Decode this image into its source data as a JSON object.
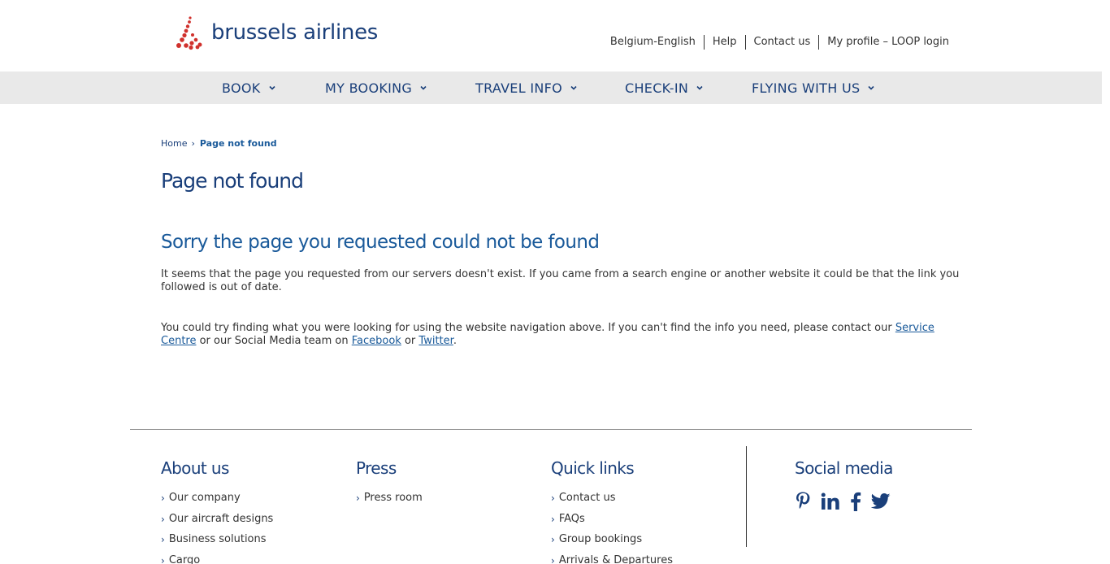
{
  "header": {
    "logo_text": "brussels airlines",
    "util_nav": [
      "Belgium-English",
      "Help",
      "Contact us",
      "My profile – LOOP login"
    ]
  },
  "main_nav": [
    "BOOK",
    "MY BOOKING",
    "TRAVEL INFO",
    "CHECK-IN",
    "FLYING WITH US"
  ],
  "breadcrumb": {
    "home": "Home",
    "current": "Page not found"
  },
  "content": {
    "title": "Page not found",
    "subtitle": "Sorry the page you requested could not be found",
    "para1": "It seems that the page you requested from our servers doesn't exist. If you came from a search engine or another website it could be that the link you followed is out of date.",
    "para2_start": "You could try finding what you were looking for using the website navigation above. If you can't find the info you need, please contact our ",
    "service_centre": "Service Centre",
    "para2_mid": " or our Social Media team on ",
    "facebook": "Facebook",
    "para2_or": " or ",
    "twitter": "Twitter",
    "para2_end": "."
  },
  "footer": {
    "about": {
      "title": "About us",
      "links": [
        "Our company",
        "Our aircraft designs",
        "Business solutions",
        "Cargo"
      ]
    },
    "press": {
      "title": "Press",
      "links": [
        "Press room"
      ]
    },
    "quick": {
      "title": "Quick links",
      "links": [
        "Contact us",
        "FAQs",
        "Group bookings",
        "Arrivals & Departures"
      ]
    },
    "social": {
      "title": "Social media",
      "icons": [
        "pinterest-icon",
        "linkedin-icon",
        "facebook-icon",
        "twitter-icon"
      ]
    }
  },
  "colors": {
    "brand_navy": "#1a3f7a",
    "link_blue": "#1a5a9a",
    "logo_red": "#d0312d",
    "nav_bg": "#e9e9e9"
  }
}
